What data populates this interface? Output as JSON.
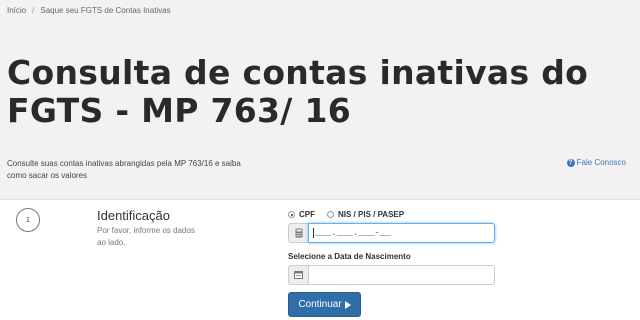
{
  "breadcrumb": {
    "home": "Início",
    "separator": "/",
    "current": "Saque seu FGTS de Contas Inativas"
  },
  "hero": {
    "title_line1": "Consulta de contas inativas do",
    "title_line2": "FGTS - MP 763/ 16",
    "subtitle_line1": "Consulte suas contas inativas abrangidas pela MP 763/16 e saiba",
    "subtitle_line2": "como sacar os valores",
    "contact_label": "Fale Conosco",
    "contact_icon": "question-circle-icon"
  },
  "step": {
    "number": "1",
    "title": "Identificação",
    "desc_line1": "Por favor, informe os dados",
    "desc_line2": "ao lado."
  },
  "form": {
    "doc_options": [
      {
        "label": "CPF",
        "checked": true
      },
      {
        "label": "NIS / PIS / PASEP",
        "checked": false
      }
    ],
    "doc_value": "___.___.___-__",
    "doc_icon": "calculator-icon",
    "dob_label": "Selecione a Data de Nascimento",
    "dob_value": "",
    "dob_icon": "calendar-icon",
    "submit_label": "Continuar"
  },
  "colors": {
    "accent": "#2f6ea8",
    "link": "#3a78b5",
    "hero_bg": "#f2f2f2"
  }
}
